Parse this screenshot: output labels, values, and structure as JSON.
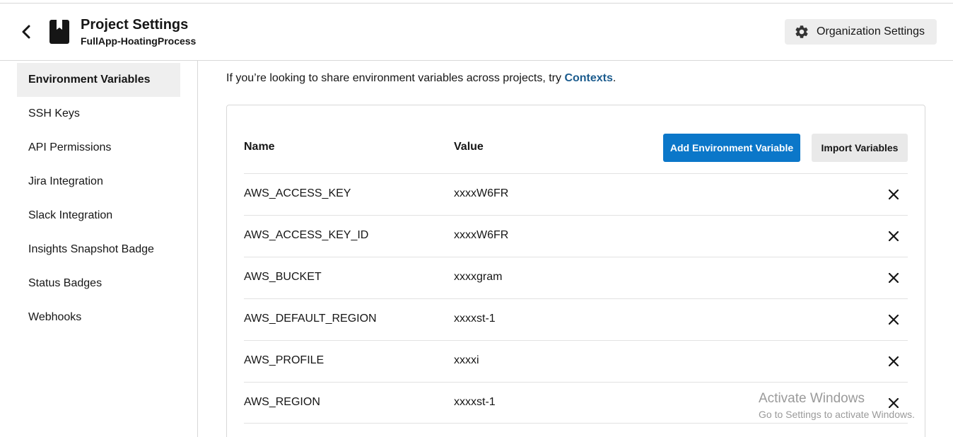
{
  "header": {
    "title": "Project Settings",
    "project_name": "FullApp-HoatingProcess",
    "org_settings_label": "Organization Settings"
  },
  "sidebar": {
    "items": [
      {
        "label": "Environment Variables",
        "active": true
      },
      {
        "label": "SSH Keys"
      },
      {
        "label": "API Permissions"
      },
      {
        "label": "Jira Integration"
      },
      {
        "label": "Slack Integration"
      },
      {
        "label": "Insights Snapshot Badge"
      },
      {
        "label": "Status Badges"
      },
      {
        "label": "Webhooks"
      }
    ]
  },
  "main": {
    "info_text": "If you’re looking to share environment variables across projects, try ",
    "info_link": "Contexts",
    "info_end": "."
  },
  "table": {
    "headers": {
      "name": "Name",
      "value": "Value"
    },
    "add_button": "Add Environment Variable",
    "import_button": "Import Variables",
    "rows": [
      {
        "name": "AWS_ACCESS_KEY",
        "value": "xxxxW6FR"
      },
      {
        "name": "AWS_ACCESS_KEY_ID",
        "value": "xxxxW6FR"
      },
      {
        "name": "AWS_BUCKET",
        "value": "xxxxgram"
      },
      {
        "name": "AWS_DEFAULT_REGION",
        "value": "xxxxst-1"
      },
      {
        "name": "AWS_PROFILE",
        "value": "xxxxi"
      },
      {
        "name": "AWS_REGION",
        "value": "xxxxst-1"
      }
    ]
  },
  "watermark": {
    "title": "Activate Windows",
    "subtitle": "Go to Settings to activate Windows."
  },
  "icons": {
    "back": "chevron-left-icon",
    "project": "bookmark-icon",
    "org": "gear-icon",
    "delete": "close-icon"
  },
  "colors": {
    "primary_button": "#0b77c9",
    "link": "#1c5c8e",
    "active_sidebar": "#efefef"
  }
}
